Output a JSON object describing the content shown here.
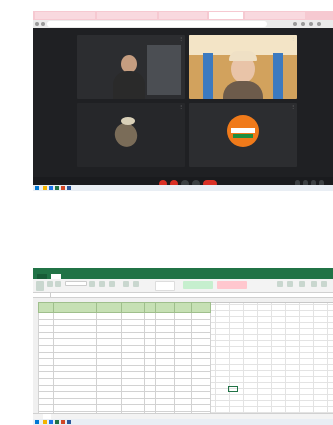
{
  "colors": {
    "meet_background": "#1f2023",
    "end_call_red": "#d93025",
    "excel_green": "#217346",
    "table_header_green": "#c6e0b4",
    "browser_tab_pink": "#f6c9d1"
  },
  "meeting": {
    "tiles": [
      {
        "name": "",
        "kind": "camera"
      },
      {
        "name": "",
        "kind": "camera"
      },
      {
        "name": "",
        "kind": "camera"
      },
      {
        "name": "",
        "kind": "logo-avatar"
      }
    ],
    "logo_text": "",
    "call_time": "",
    "icons": [
      "mic-off-icon",
      "camera-off-icon",
      "present-icon",
      "raise-hand-icon",
      "end-call-icon"
    ]
  },
  "spreadsheet": {
    "sheet_tab": "",
    "name_box": "",
    "columns": [
      "",
      "",
      "",
      "",
      "",
      "",
      "",
      ""
    ],
    "row_count": 18
  }
}
